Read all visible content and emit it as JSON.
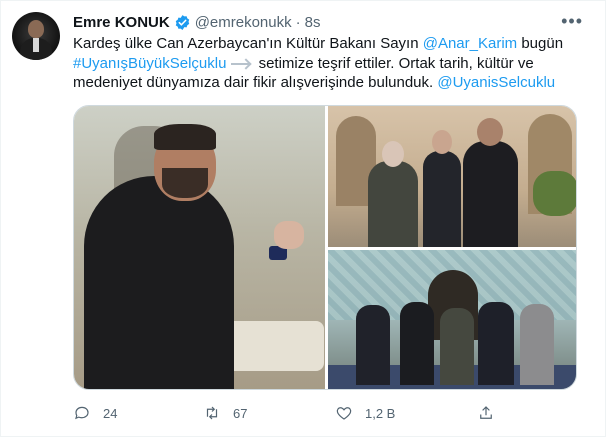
{
  "author": {
    "name": "Emre KONUK",
    "handle": "@emrekonukk",
    "separator": "·",
    "time": "8s"
  },
  "more_label": "•••",
  "tweet": {
    "part1": "Kardeş ülke Can Azerbaycan'ın Kültür Bakanı Sayın ",
    "mention1": "@Anar_Karim",
    "part2": " bugün ",
    "hashtag": "#UyanışBüyükSelçuklu",
    "part3": " setimize teşrif ettiler. Ortak tarih, kültür ve medeniyet dünyamıza dair fikir alışverişinde bulunduk. ",
    "mention2": "@UyanisSelcuklu"
  },
  "actions": {
    "reply_count": "24",
    "retweet_count": "67",
    "like_count": "1,2 B"
  },
  "colors": {
    "link": "#1d9bf0",
    "verified": "#1d9bf0",
    "muted": "#536471"
  },
  "icons": {
    "verified": "verified-badge-icon",
    "reply": "reply-icon",
    "retweet": "retweet-icon",
    "like": "like-icon",
    "share": "share-icon"
  }
}
